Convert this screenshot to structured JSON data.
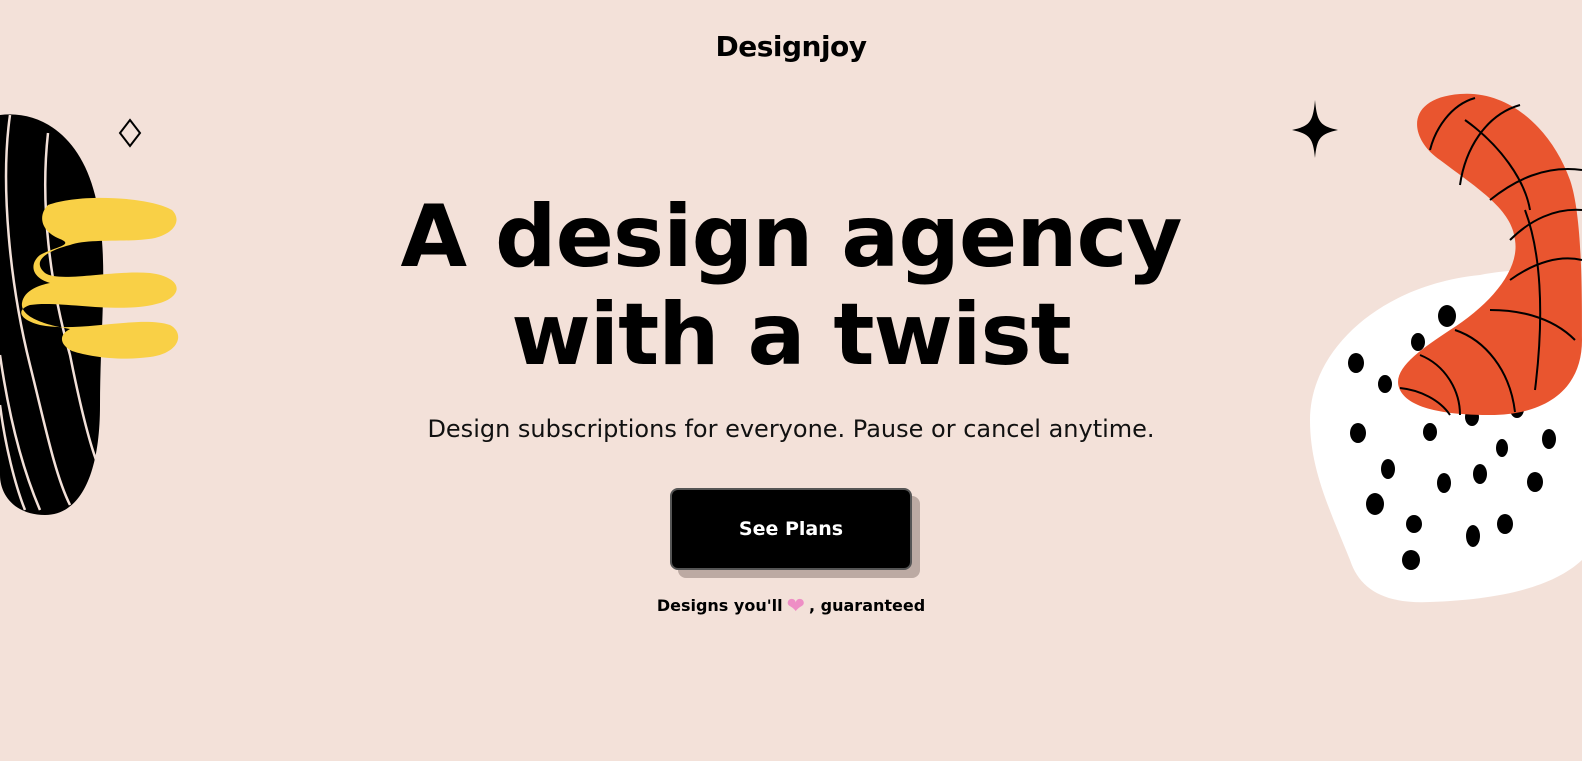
{
  "header": {
    "logo_text": "Designjoy"
  },
  "hero": {
    "title_line_1": "A design agency",
    "title_line_2": "with a twist",
    "subtitle": "Design subscriptions for everyone. Pause or cancel anytime.",
    "cta_label": "See Plans",
    "tagline_before": "Designs you'll",
    "tagline_after": ", guaranteed",
    "tagline_icon": "heart-icon"
  },
  "colors": {
    "background": "#f3e1d9",
    "text": "#000000",
    "accent_yellow": "#f9d046",
    "accent_orange": "#e9552f",
    "accent_pink": "#ee8ec5",
    "white": "#ffffff"
  },
  "decorations": {
    "left": [
      "striped-black-blob",
      "yellow-squiggle",
      "diamond-outline-icon"
    ],
    "right": [
      "sparkle-star-icon",
      "orange-striped-worm",
      "white-dotted-blob"
    ]
  }
}
